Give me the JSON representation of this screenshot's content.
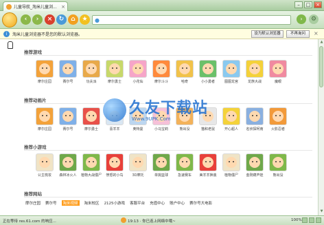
{
  "window": {
    "tab_title": "儿童导航_淘米儿童浏...",
    "tab_close": "×",
    "controls": [
      "–",
      "□",
      "×"
    ]
  },
  "toolbar": {
    "back": "‹",
    "forward": "›",
    "stop": "×",
    "refresh": "↻",
    "home": "⌂",
    "fav": "★",
    "address_value": "",
    "go": "›",
    "gear": "⚙"
  },
  "notice": {
    "icon": "i",
    "text": "淘米儿童浏览器不是您的默认浏览器。",
    "set_default": "设为默认浏览器",
    "dont_ask": "不再询问",
    "close": "×"
  },
  "sections": [
    {
      "title": "推荐游戏",
      "items": [
        "摩尔庄园",
        "赛尔号",
        "功夫派",
        "摩尔勇士",
        "小花仙",
        "摩尔斗斗",
        "哈奇",
        "小小勇者",
        "图图龙宫",
        "龙族大战",
        "魔眼"
      ],
      "colors": [
        "#f3a23a",
        "#7fb0e8",
        "#e8a94a",
        "#c7d86a",
        "#f6a5c8",
        "#ff8a3c",
        "#f1c24a",
        "#6bc06a",
        "#8ac9ef",
        "#f4d13a",
        "#f08aa0"
      ]
    },
    {
      "title": "推荐动画片",
      "items": [
        "摩尔庄园",
        "赛尔号",
        "摩尔勇士",
        "喜羊羊",
        "奥特曼",
        "小马宝莉",
        "熊出没",
        "猫和老鼠",
        "开心超人",
        "名侦探柯南",
        "火影忍者"
      ],
      "colors": [
        "#f3a23a",
        "#7fb0e8",
        "#e8514a",
        "#d9e6f2",
        "#bcd6f0",
        "#f6c0d8",
        "#f3b25a",
        "#e7e7e7",
        "#f4d23a",
        "#8ab0e0",
        "#f29a3a"
      ]
    },
    {
      "title": "推荐小游戏",
      "items": [
        "公主梳妆",
        "森林冰火人",
        "植物大战僵尸",
        "愤怒的小鸟",
        "3D摩托",
        "单挑篮球",
        "急速赛车",
        "美羊羊换装",
        "植物僵尸",
        "金刚葫芦娃",
        "熊出没"
      ],
      "colors": [
        "#f0e4c6",
        "#6fa84a",
        "#7fb84a",
        "#e8403a"
      ]
    }
  ],
  "links_section": {
    "title": "推荐网站",
    "links": [
      "摩尔庄园",
      "赛尔号",
      "淘米视频",
      "淘米校区",
      "2125小游戏",
      "客服平台",
      "充值中心",
      "账户中心",
      "赛尔号大电影"
    ],
    "active_index": 2
  },
  "watermark": {
    "text": "久友下载站",
    "url": "Www.9UPK.Com"
  },
  "statusbar": {
    "left": "正在等待 res.61.com 的响应...",
    "middle": "19:13 · 你已连上网络中哦~",
    "zoom": "100%"
  }
}
